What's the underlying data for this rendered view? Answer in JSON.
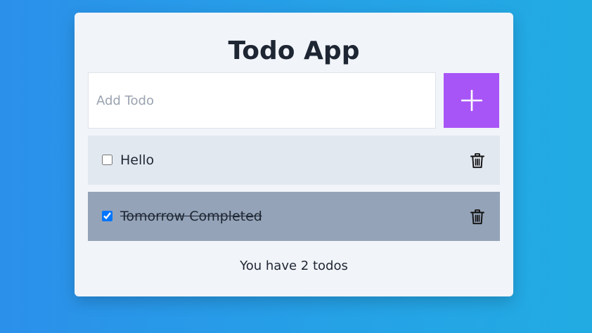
{
  "app": {
    "title": "Todo App"
  },
  "add_todo": {
    "placeholder": "Add Todo",
    "value": "",
    "button_icon": "plus-icon"
  },
  "todos": [
    {
      "text": "Hello",
      "completed": false,
      "delete_icon": "trash-icon"
    },
    {
      "text": "Tomorrow Completed",
      "completed": true,
      "delete_icon": "trash-icon"
    }
  ],
  "footer": {
    "count_text": "You have 2 todos"
  },
  "colors": {
    "background_gradient_start": "#2b90ea",
    "background_gradient_end": "#22abe3",
    "card_background": "#f1f4f9",
    "add_button": "#a855f7",
    "todo_item_active": "#e2e8f0",
    "todo_item_completed": "#94a3b8",
    "text": "#1e2633"
  }
}
